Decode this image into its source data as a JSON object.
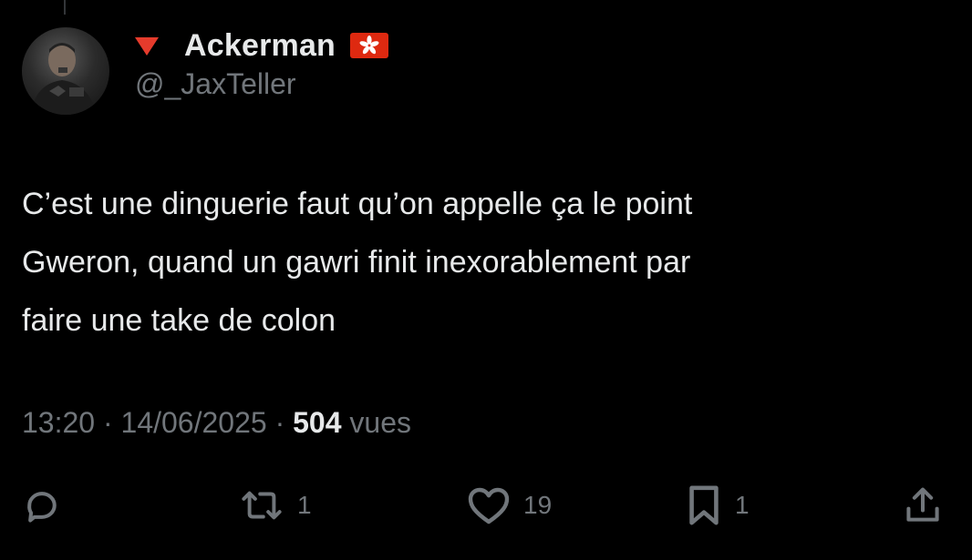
{
  "tweet": {
    "author": {
      "display_name": "Ackerman",
      "handle": "@_JaxTeller",
      "prefix_icon": "red-triangle-down-icon",
      "flag_icon": "hong-kong-flag-icon"
    },
    "text": "C’est une dinguerie faut qu’on appelle ça le point\nGweron, quand un gawri finit inexorablement par\nfaire une take de colon",
    "meta": {
      "time": "13:20",
      "separator": "·",
      "date": "14/06/2025",
      "views_count": "504",
      "views_label": "vues"
    },
    "actions": {
      "reply": {
        "icon": "reply-icon",
        "count": ""
      },
      "retweet": {
        "icon": "retweet-icon",
        "count": "1"
      },
      "like": {
        "icon": "heart-icon",
        "count": "19"
      },
      "bookmark": {
        "icon": "bookmark-icon",
        "count": "1"
      },
      "share": {
        "icon": "share-icon",
        "count": ""
      }
    }
  },
  "colors": {
    "background": "#000000",
    "text_primary": "#e7e9ea",
    "text_secondary": "#71767b",
    "triangle": "#e53b2c",
    "flag_red": "#de2910"
  }
}
